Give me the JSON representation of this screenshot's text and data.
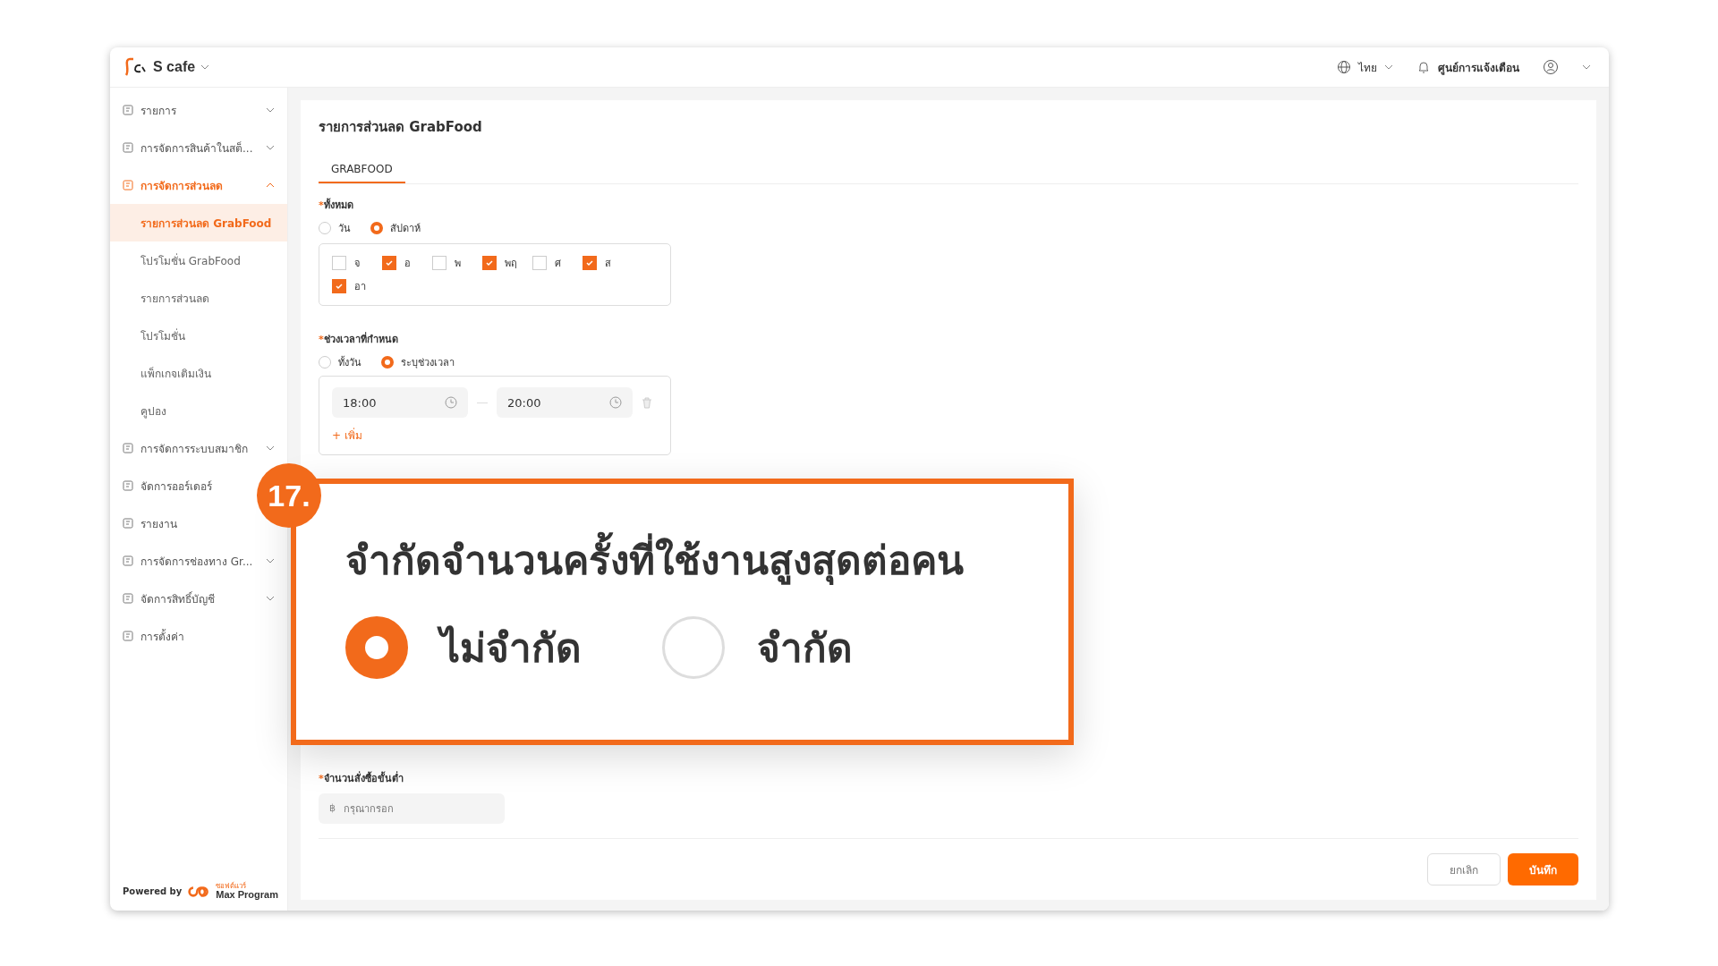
{
  "header": {
    "brand": "S cafe",
    "language": "ไทย",
    "notifications": "ศูนย์การแจ้งเตือน"
  },
  "sidebar": {
    "items": [
      {
        "label": "รายการ",
        "expanded": false,
        "selected": false
      },
      {
        "label": "การจัดการสินค้าในสต็...",
        "expanded": false,
        "selected": false
      },
      {
        "label": "การจัดการส่วนลด",
        "expanded": true,
        "selected": true,
        "children": [
          {
            "label": "รายการส่วนลด GrabFood",
            "selected": true
          },
          {
            "label": "โปรโมชั่น GrabFood",
            "selected": false
          },
          {
            "label": "รายการส่วนลด",
            "selected": false
          },
          {
            "label": "โปรโมชั่น",
            "selected": false
          },
          {
            "label": "แพ็กเกจเติมเงิน",
            "selected": false
          },
          {
            "label": "คูปอง",
            "selected": false
          }
        ]
      },
      {
        "label": "การจัดการระบบสมาชิก",
        "expanded": false,
        "selected": false
      },
      {
        "label": "จัดการออร์เดอร์",
        "selected": false
      },
      {
        "label": "รายงาน",
        "selected": false
      },
      {
        "label": "การจัดการช่องทาง Gr...",
        "expanded": false,
        "selected": false
      },
      {
        "label": "จัดการสิทธิ์บัญชี",
        "expanded": false,
        "selected": false
      },
      {
        "label": "การตั้งค่า",
        "selected": false
      }
    ],
    "footer": {
      "powered_by": "Powered by",
      "logo_small": "ซอฟต์แวร์",
      "logo_text": "Max Program"
    }
  },
  "page": {
    "title": "รายการส่วนลด GrabFood",
    "tabs": [
      {
        "label": "GRABFOOD",
        "selected": true
      }
    ]
  },
  "period": {
    "label": "ทั้งหมด",
    "required_mark": "*",
    "options": [
      {
        "label": "วัน",
        "selected": false
      },
      {
        "label": "สัปดาห์",
        "selected": true
      }
    ],
    "days": [
      {
        "label": "จ",
        "checked": false
      },
      {
        "label": "อ",
        "checked": true
      },
      {
        "label": "พ",
        "checked": false
      },
      {
        "label": "พฤ",
        "checked": true
      },
      {
        "label": "ศ",
        "checked": false
      },
      {
        "label": "ส",
        "checked": true
      },
      {
        "label": "อา",
        "checked": true
      }
    ]
  },
  "time_range": {
    "label": "ช่วงเวลาที่กำหนด",
    "required_mark": "*",
    "options": [
      {
        "label": "ทั้งวัน",
        "selected": false
      },
      {
        "label": "ระบุช่วงเวลา",
        "selected": true
      }
    ],
    "ranges": [
      {
        "start": "18:00",
        "end": "20:00"
      }
    ],
    "add": "+ เพิ่ม"
  },
  "callout": {
    "step": "17.",
    "title": "จำกัดจำนวนครั้งที่ใช้งานสูงสุดต่อคน",
    "options": [
      {
        "label": "ไม่จำกัด",
        "selected": true
      },
      {
        "label": "จำกัด",
        "selected": false
      }
    ]
  },
  "min_order": {
    "label": "จำนวนสั่งซื้อขั้นต่ำ",
    "required_mark": "*",
    "prefix": "฿",
    "placeholder": "กรุณากรอก"
  },
  "buttons": [
    {
      "label": "ยกเลิก",
      "kind": "secondary"
    },
    {
      "label": "บันทึก",
      "kind": "primary"
    }
  ]
}
